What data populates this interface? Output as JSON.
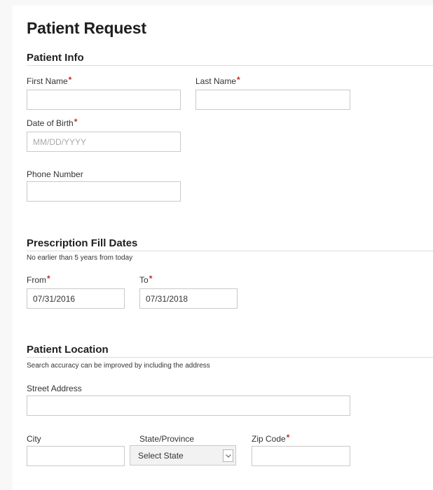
{
  "form": {
    "title": "Patient Request"
  },
  "patient_info": {
    "heading": "Patient Info",
    "first_name": {
      "label": "First Name",
      "value": ""
    },
    "last_name": {
      "label": "Last Name",
      "value": ""
    },
    "dob": {
      "label": "Date of Birth",
      "value": "",
      "placeholder": "MM/DD/YYYY"
    },
    "phone": {
      "label": "Phone Number",
      "value": ""
    }
  },
  "fill_dates": {
    "heading": "Prescription Fill Dates",
    "note": "No earlier than 5 years from today",
    "from": {
      "label": "From",
      "value": "07/31/2016"
    },
    "to": {
      "label": "To",
      "value": "07/31/2018"
    }
  },
  "location": {
    "heading": "Patient Location",
    "note": "Search accuracy can be improved by including the address",
    "street": {
      "label": "Street Address",
      "value": ""
    },
    "city": {
      "label": "City",
      "value": ""
    },
    "state": {
      "label": "State/Province",
      "selected": "Select State"
    },
    "zip": {
      "label": "Zip Code",
      "value": ""
    }
  },
  "required_marker": "*",
  "colors": {
    "required": "#c62828",
    "input_border": "#c9c9c9",
    "divider": "#dcdcdc"
  }
}
